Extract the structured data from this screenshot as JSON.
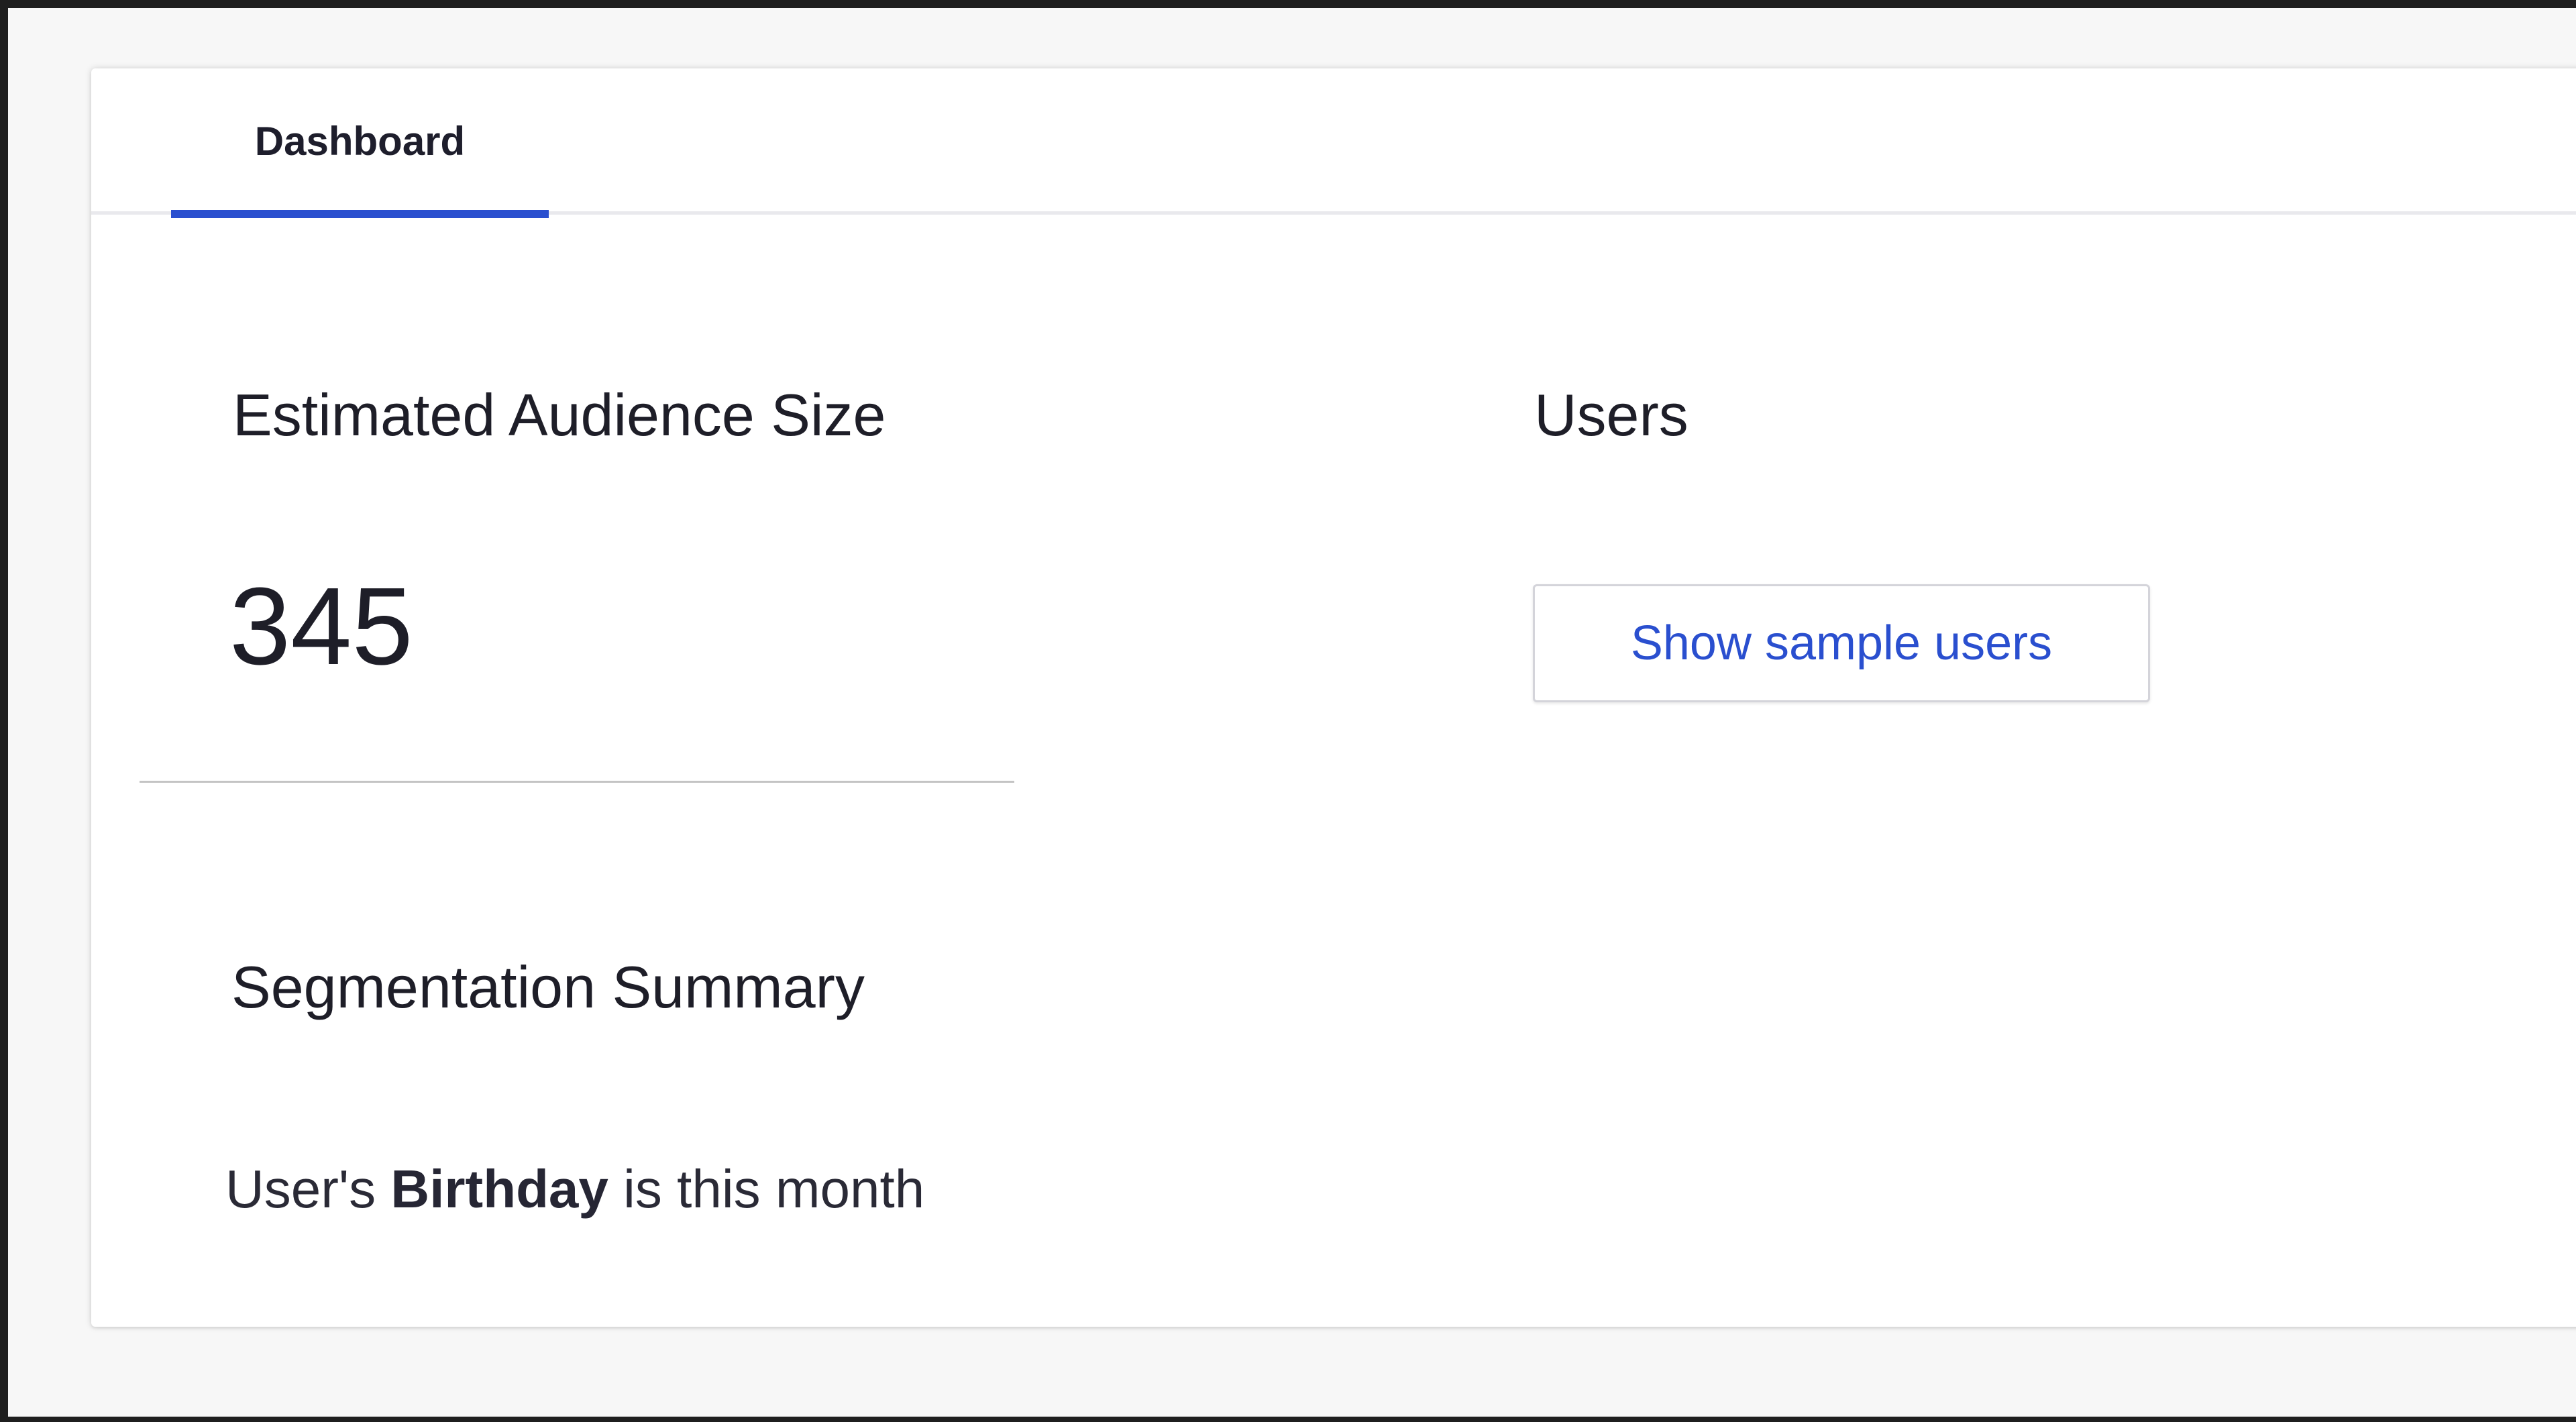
{
  "tabs": [
    {
      "label": "Dashboard",
      "active": true
    }
  ],
  "audience": {
    "title": "Estimated Audience Size",
    "value": "345"
  },
  "users": {
    "title": "Users",
    "button_label": "Show sample users"
  },
  "segmentation": {
    "title": "Segmentation Summary",
    "rule": {
      "prefix": "User's",
      "attribute": "Birthday",
      "suffix": "is this month"
    }
  },
  "colors": {
    "accent": "#2a4fcf",
    "text": "#1e1e28",
    "page_background": "#f7f7f7",
    "card_background": "#ffffff"
  }
}
